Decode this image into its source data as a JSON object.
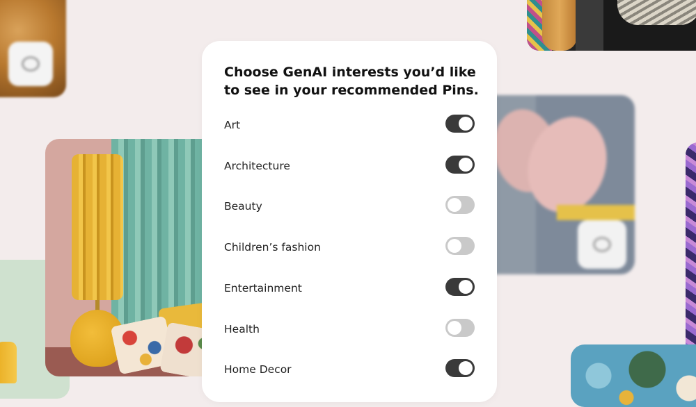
{
  "card": {
    "title": "Choose GenAI interests you’d like to see in your recommended Pins.",
    "interests": [
      {
        "label": "Art",
        "enabled": true
      },
      {
        "label": "Architecture",
        "enabled": true
      },
      {
        "label": "Beauty",
        "enabled": false
      },
      {
        "label": "Children’s fashion",
        "enabled": false
      },
      {
        "label": "Entertainment",
        "enabled": true
      },
      {
        "label": "Health",
        "enabled": false
      },
      {
        "label": "Home Decor",
        "enabled": true
      }
    ]
  },
  "colors": {
    "background": "#f3ecec",
    "card": "#ffffff",
    "toggle_on": "#3a3a3a",
    "toggle_off": "#c9c9c9"
  },
  "icons": {
    "ai_badge": "ai-modified-badge-icon"
  }
}
